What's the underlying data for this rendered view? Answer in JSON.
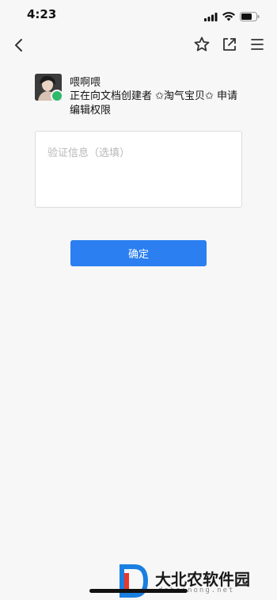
{
  "status_bar": {
    "time": "4:23",
    "icons": [
      "signal-icon",
      "wifi-icon",
      "battery-icon"
    ]
  },
  "nav": {
    "icons": [
      "back-icon",
      "star-icon",
      "share-icon",
      "menu-icon"
    ]
  },
  "request": {
    "username": "喂啊喂",
    "message": "正在向文档创建者 ✩淘气宝贝✩ 申请编辑权限"
  },
  "verify": {
    "placeholder": "验证信息（选填）",
    "value": ""
  },
  "confirm_button": {
    "label": "确定"
  },
  "watermark": {
    "title": "大北农软件园",
    "domain": "dabeinong.net"
  },
  "colors": {
    "accent": "#2b7ff0",
    "background": "#f7f7f8",
    "avatar_badge": "#2fb96a"
  }
}
